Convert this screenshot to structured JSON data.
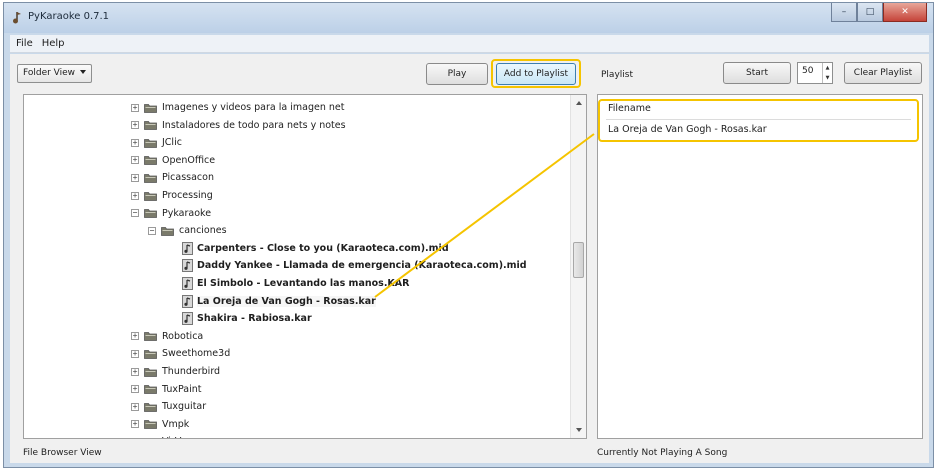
{
  "window": {
    "title": "PyKaraoke 0.7.1",
    "controls": {
      "minimize": "–",
      "maximize": "□",
      "close": "✕"
    }
  },
  "menu": {
    "file": "File",
    "help": "Help"
  },
  "toolbar": {
    "view_select": "Folder View",
    "play_label": "Play",
    "add_to_playlist_label": "Add to Playlist",
    "playlist_label": "Playlist",
    "start_label": "Start",
    "start_value": "50",
    "clear_playlist_label": "Clear Playlist"
  },
  "tree": {
    "folders_top": [
      "Imagenes y videos para la imagen net",
      "Instaladores de todo para nets y notes",
      "JClic",
      "OpenOffice",
      "Picassacon",
      "Processing"
    ],
    "pykaraoke_folder": "Pykaraoke",
    "canciones_folder": "canciones",
    "files": [
      "Carpenters - Close to you (Karaoteca.com).mid",
      "Daddy Yankee - Llamada de emergencia (Karaoteca.com).mid",
      "El Simbolo - Levantando las manos.KAR",
      "La Oreja de Van Gogh - Rosas.kar",
      "Shakira - Rabiosa.kar"
    ],
    "folders_bottom": [
      "Robotica",
      "Sweethome3d",
      "Thunderbird",
      "TuxPaint",
      "Tuxguitar",
      "Vmpk",
      "VirVare"
    ]
  },
  "playlist": {
    "column_header": "Filename",
    "rows": [
      "La Oreja de Van Gogh - Rosas.kar"
    ]
  },
  "status": {
    "left": "File Browser View",
    "right": "Currently Not Playing A Song"
  },
  "colors": {
    "highlight": "#f5c400",
    "window_frame": "#c9d9ea",
    "close_button": "#c5443a"
  }
}
